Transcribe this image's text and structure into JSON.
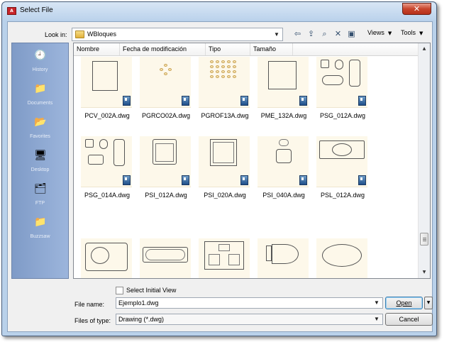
{
  "window": {
    "title": "Select File",
    "app_icon_text": "A",
    "close_glyph": "✕"
  },
  "toolbar": {
    "look_in_label": "Look in:",
    "look_in_value": "WBloques",
    "views_label": "Views",
    "tools_label": "Tools",
    "icons": [
      "back-icon",
      "up-folder-icon",
      "search-web-icon",
      "delete-icon",
      "new-folder-icon"
    ]
  },
  "places": [
    {
      "label": "History",
      "icon": "history-icon",
      "glyph": "🕘"
    },
    {
      "label": "Documents",
      "icon": "documents-icon",
      "glyph": "📁"
    },
    {
      "label": "Favorites",
      "icon": "favorites-icon",
      "glyph": "📂"
    },
    {
      "label": "Desktop",
      "icon": "desktop-icon",
      "glyph": "🖥"
    },
    {
      "label": "FTP",
      "icon": "ftp-icon",
      "glyph": "🗂"
    },
    {
      "label": "Buzzsaw",
      "icon": "buzzsaw-icon",
      "glyph": "📁"
    }
  ],
  "columns": [
    "Nombre",
    "Fecha de modificación",
    "Tipo",
    "Tamaño"
  ],
  "files": [
    {
      "name": "PCV_002A.dwg"
    },
    {
      "name": "PGRCO02A.dwg"
    },
    {
      "name": "PGROF13A.dwg"
    },
    {
      "name": "PME_132A.dwg"
    },
    {
      "name": "PSG_012A.dwg"
    },
    {
      "name": "PSG_014A.dwg"
    },
    {
      "name": "PSI_012A.dwg"
    },
    {
      "name": "PSI_020A.dwg"
    },
    {
      "name": "PSI_040A.dwg"
    },
    {
      "name": "PSL_012A.dwg"
    },
    {
      "name": ""
    },
    {
      "name": ""
    },
    {
      "name": ""
    },
    {
      "name": ""
    },
    {
      "name": ""
    }
  ],
  "options": {
    "select_initial_view": "Select Initial View",
    "select_initial_view_checked": false
  },
  "file_name": {
    "label": "File name:",
    "value": "Ejemplo1.dwg"
  },
  "files_of_type": {
    "label": "Files of type:",
    "value": "Drawing (*.dwg)"
  },
  "buttons": {
    "open": "Open",
    "cancel": "Cancel"
  }
}
